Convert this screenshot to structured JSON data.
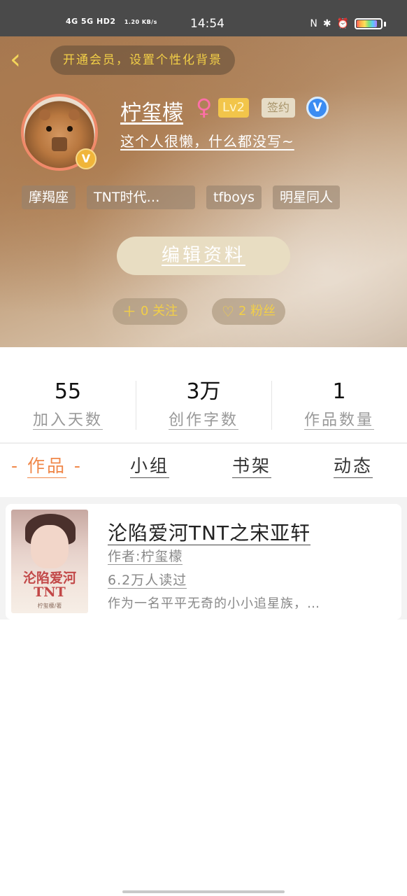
{
  "status_bar": {
    "network": "4G 5G HD2",
    "speed": "1.20 KB/s",
    "time": "14:54",
    "right_icons": [
      "nfc-icon",
      "bluetooth-icon",
      "alarm-icon",
      "battery-icon"
    ],
    "battery_level": 0.8
  },
  "header": {
    "back_label": "‹",
    "vip_banner": "开通会员，设置个性化背景"
  },
  "profile": {
    "username": "柠玺檬",
    "gender_symbol": "♀",
    "level": "Lv2",
    "signed": "签约",
    "verified_symbol": "V",
    "avatar_badge": "V",
    "bio": "这个人很懒，什么都没写~"
  },
  "tags": [
    "摩羯座",
    "TNT时代…",
    "tfboys",
    "明星同人"
  ],
  "edit_button": "编辑资料",
  "social": {
    "following_icon": "＋",
    "following": "0 关注",
    "fans_icon": "♡",
    "fans": "2 粉丝"
  },
  "stats": [
    {
      "value": "55",
      "label": "加入天数"
    },
    {
      "value": "3万",
      "label": "创作字数"
    },
    {
      "value": "1",
      "label": "作品数量"
    }
  ],
  "tabs": [
    {
      "label": "作品",
      "active": true
    },
    {
      "label": "小组",
      "active": false
    },
    {
      "label": "书架",
      "active": false
    },
    {
      "label": "动态",
      "active": false
    }
  ],
  "works": [
    {
      "title": "沦陷爱河TNT之宋亚轩",
      "author": "作者:柠玺檬",
      "reads": "6.2万人读过",
      "description": "作为一名平平无奇的小小追星族，…",
      "cover_title": "沦陷爱河TNT",
      "cover_subtitle": "柠玺檬/著"
    }
  ],
  "colors": {
    "accent": "#f0884a",
    "gold": "#f2cf47",
    "verify_blue": "#3b8cf2"
  }
}
